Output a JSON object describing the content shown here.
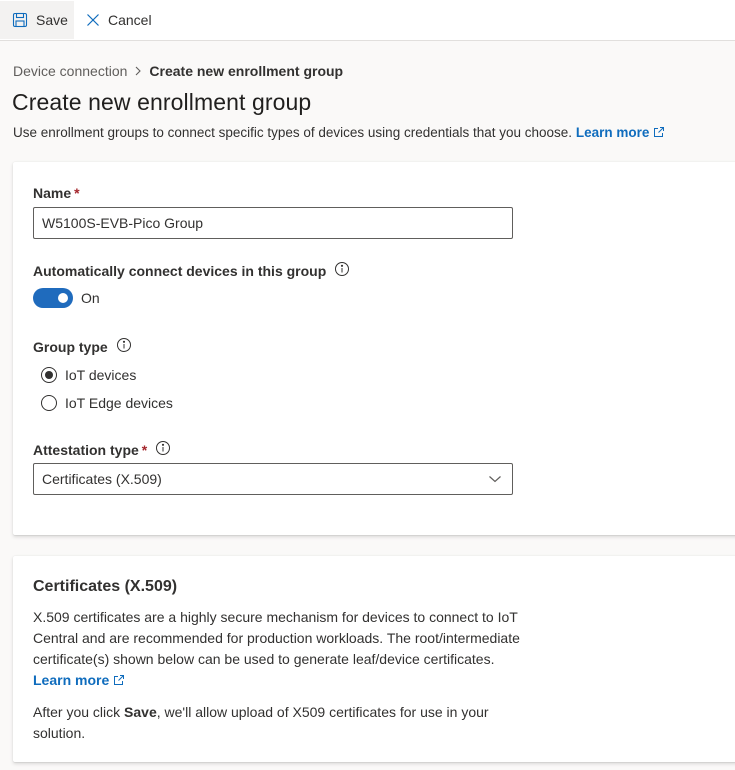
{
  "toolbar": {
    "save_label": "Save",
    "cancel_label": "Cancel"
  },
  "breadcrumb": {
    "parent": "Device connection",
    "current": "Create new enrollment group"
  },
  "page": {
    "title": "Create new enrollment group",
    "description": "Use enrollment groups to connect specific types of devices using credentials that you choose.",
    "learn_more": "Learn more"
  },
  "form": {
    "name": {
      "label": "Name",
      "required_mark": "*",
      "value": "W5100S-EVB-Pico Group"
    },
    "auto_connect": {
      "label": "Automatically connect devices in this group",
      "state_label": "On",
      "on": true
    },
    "group_type": {
      "label": "Group type",
      "options": [
        {
          "label": "IoT devices",
          "checked": true
        },
        {
          "label": "IoT Edge devices",
          "checked": false
        }
      ]
    },
    "attestation": {
      "label": "Attestation type",
      "required_mark": "*",
      "selected": "Certificates (X.509)"
    }
  },
  "certificates_card": {
    "title": "Certificates (X.509)",
    "paragraph1": "X.509 certificates are a highly secure mechanism for devices to connect to IoT Central and are recommended for production workloads. The root/intermediate certificate(s) shown below can be used to generate leaf/device certificates.",
    "learn_more": "Learn more",
    "paragraph2_prefix": "After you click ",
    "paragraph2_bold": "Save",
    "paragraph2_suffix": ", we'll allow upload of X509 certificates for use in your solution."
  },
  "colors": {
    "accent": "#0f6cbd",
    "toggle_on": "#1f6bbd",
    "required": "#a4262c",
    "page_bg": "#faf9f8"
  },
  "icons": {
    "save": "save-icon",
    "cancel": "close-icon",
    "breadcrumb_sep": "chevron-right-icon",
    "external": "external-link-icon",
    "info": "info-icon",
    "dropdown": "chevron-down-icon"
  }
}
